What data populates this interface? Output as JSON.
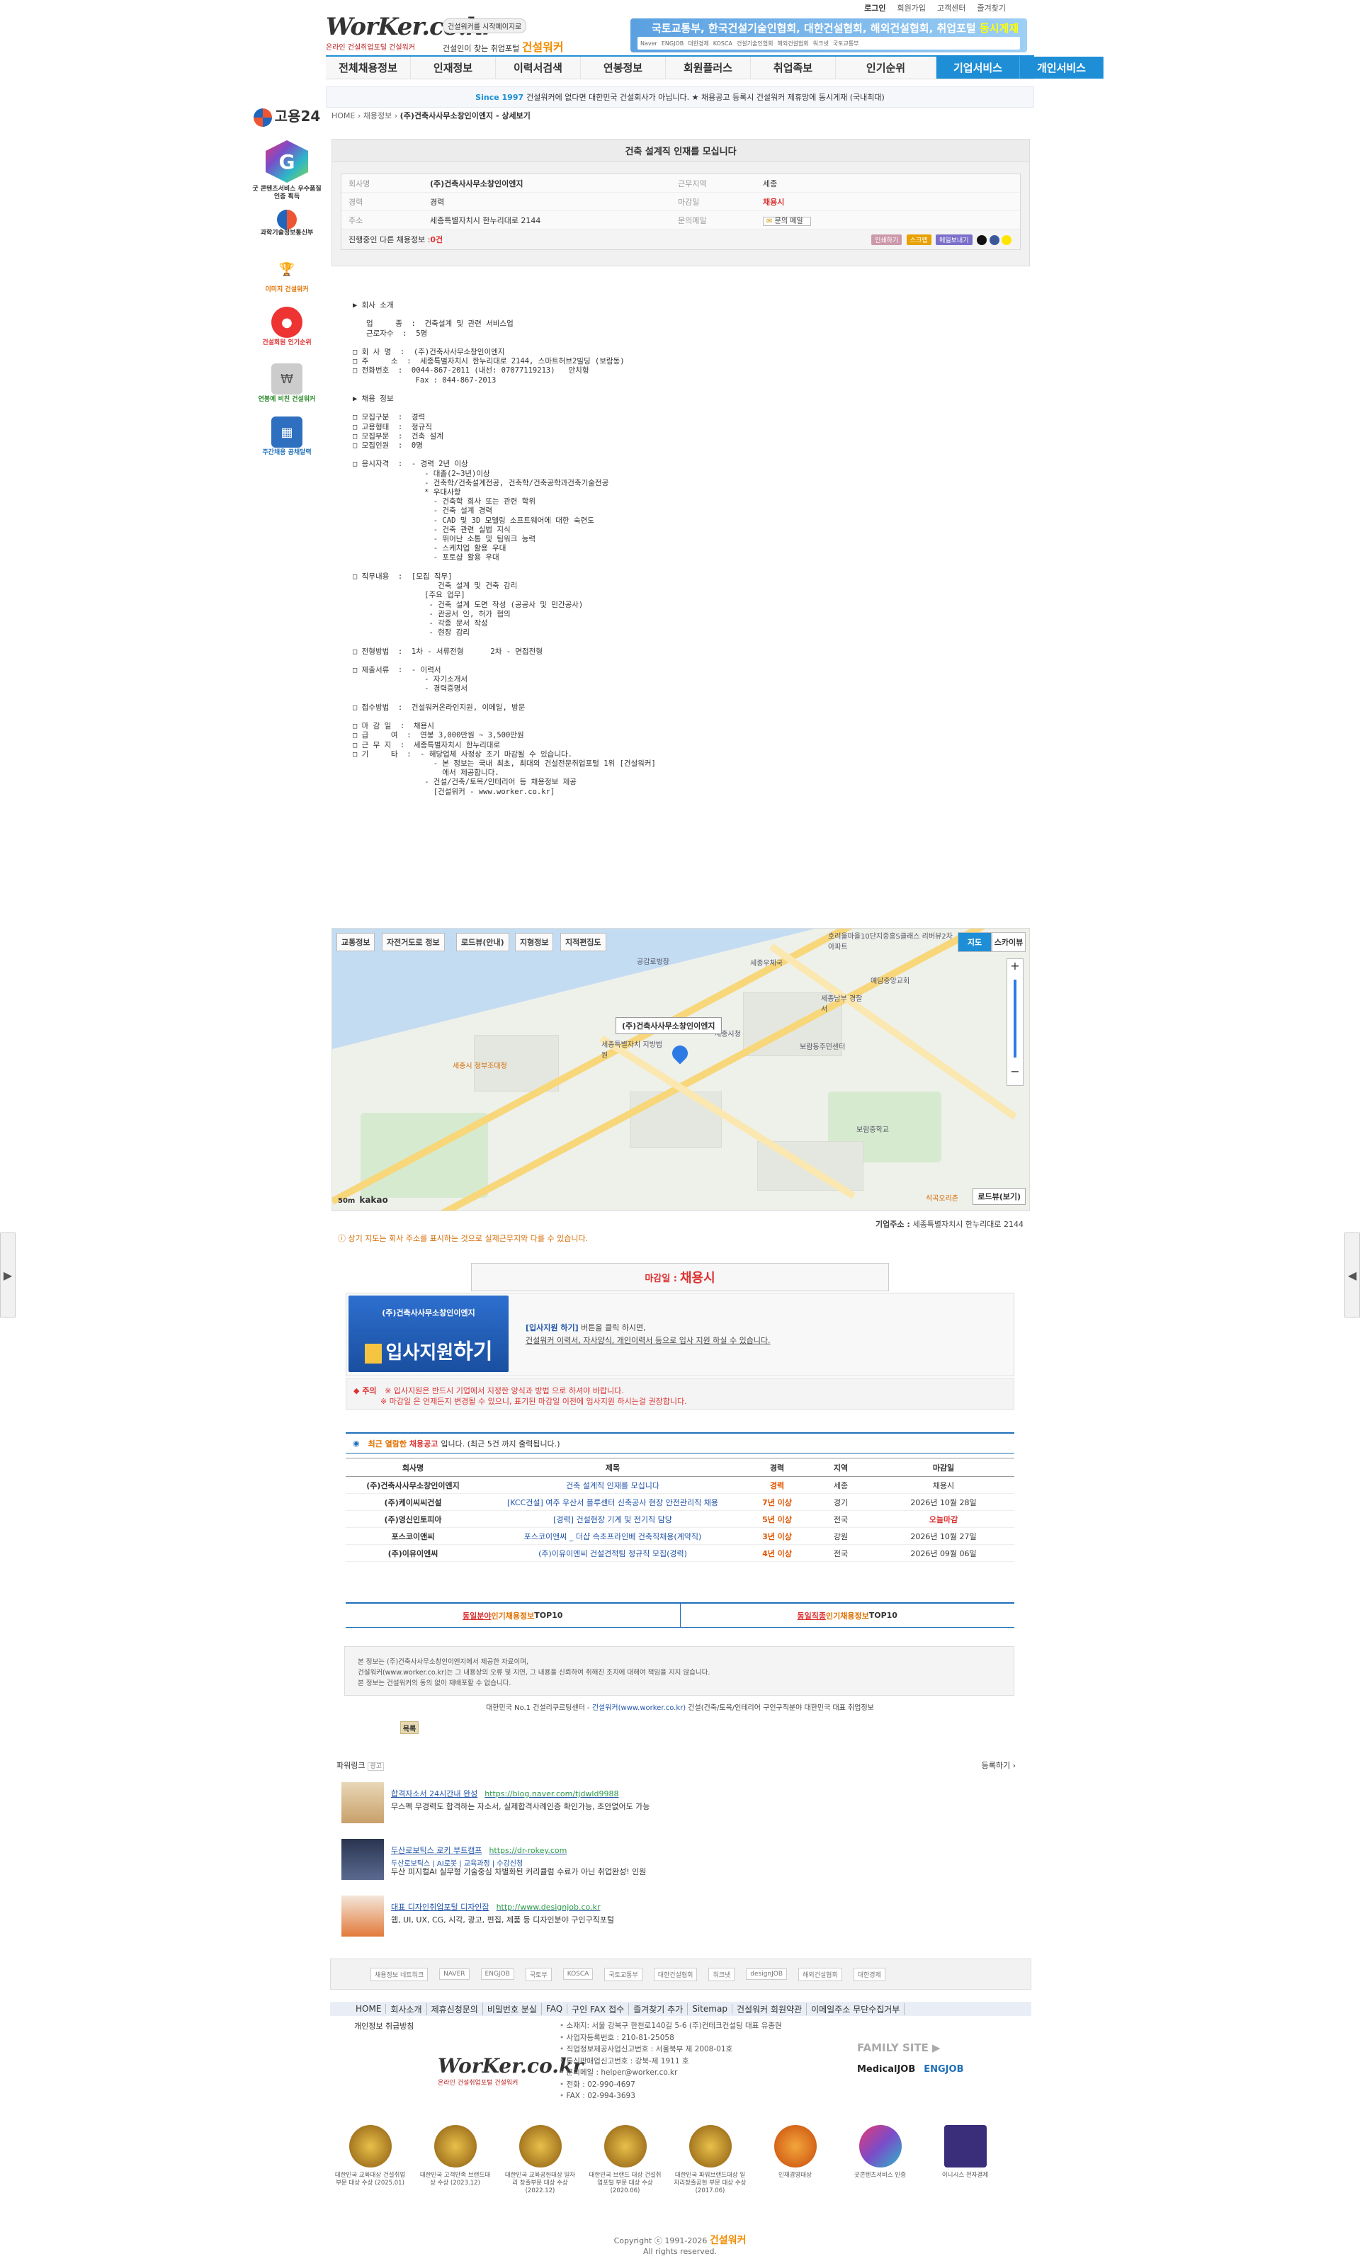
{
  "topbar": {
    "login": "로그인",
    "signup": "회원가입",
    "support": "고객센터",
    "bookmark": "즐겨찾기"
  },
  "logo": {
    "word": "WorKer.co.kr",
    "sub": "온라인 건설취업포털 건설워커"
  },
  "slogan": {
    "tag": "건설워커를 시작페이지로",
    "line": "건설인이 찾는 취업포털",
    "brand": "건설워커"
  },
  "ad_banner": {
    "text": "국토교통부, 한국건설기술인협회, 대한건설협회, 해외건설협회, 취업포털",
    "highlight": "동시게재",
    "partners": [
      "Naver",
      "ENGJOB",
      "대한경제",
      "KOSCA",
      "건설기술인협회",
      "해외건설협회",
      "워크넷",
      "국토교통부"
    ]
  },
  "nav": [
    "전체채용정보",
    "인재정보",
    "이력서검색",
    "연봉정보",
    "회원플러스",
    "취업족보",
    "인기순위",
    "기업서비스",
    "개인서비스"
  ],
  "since": {
    "year": "Since 1997",
    "text": "건설워커에 없다면 대한민국 건설회사가 아닙니다. ★ 채용공고 등록시 건설워커 제휴망에 동시게재 (국내최대)"
  },
  "rail": {
    "gov24": "고용24",
    "gcontent": "굿 콘텐츠서비스 우수품질인증 획득",
    "msit": "과학기술정보통신부",
    "item1": "이미지 건설워커",
    "item2": "건설회원 인기순위",
    "item3": "연봉에 비친 건설워커",
    "item4": "주간채용 공채달력"
  },
  "breadcrumb": {
    "home": "HOME",
    "mid": "채용정보",
    "current": "(주)건축사사무소창인이엔지 - 상세보기"
  },
  "posting": {
    "title": "건축 설계직 인재를 모십니다",
    "company_k": "회사명",
    "company": "(주)건축사사무소창인이엔지",
    "location_k": "근무지역",
    "location": "세종",
    "exp_k": "경력",
    "exp": "경력",
    "deadline_k": "마감일",
    "deadline": "채용시",
    "addr_k": "주소",
    "addr": "세종특별자치시 한누리대로 2144",
    "inquiry_k": "문의메일",
    "inquiry": "문의 메일",
    "other_jobs": "진행중인 다른 채용정보 : ",
    "other_count": "0건",
    "actions": [
      "인쇄하기",
      "스크랩",
      "메일보내기"
    ]
  },
  "detail_text": "▶ 회사 소개\n\n   업     종  :  건축설계 및 관련 서비스업\n   근로자수  :  5명\n\n□ 회 사 명  :  (주)건축사사무소창인이엔지\n□ 주     소  :  세종특별자치시 한누리대로 2144, 스마트허브2빌딩 (보람동)\n□ 전화번호  :  0044-867-2011 (내선: 07077119213)   안치형\n              Fax : 044-867-2013\n\n▶ 채용 정보\n\n□ 모집구분  :  경력\n□ 고용형태  :  정규직\n□ 모집부문  :  건축 설계\n□ 모집인원  :  0명\n\n□ 응시자격  :  - 경력 2년 이상\n                - 대졸(2~3년)이상\n                - 건축학/건축설계전공, 건축학/건축공학과건축기술전공\n                * 우대사항\n                  - 건축학 회사 또는 관련 학위\n                  - 건축 설계 경력\n                  - CAD 및 3D 모델링 소프트웨어에 대한 숙련도\n                  - 건축 관련 실법 지식\n                  - 뛰어난 소통 및 팀워크 능력\n                  - 스케치업 활용 우대\n                  - 포토샵 활용 우대\n\n□ 직무내용  :  [모집 직무]\n                   건축 설계 및 건축 감리\n                [주요 업무]\n                 - 건축 설계 도면 작성 (공공사 및 민간공사)\n                 - 관공서 인, 허가 협의\n                 - 각종 문서 작성\n                 - 현장 감리\n\n□ 전형방법  :  1차 - 서류전형      2차 - 면접전형\n\n□ 제출서류  :  - 이력서\n                - 자기소개서\n                - 경력증명서\n\n□ 접수방법  :  건설워커온라인지원, 이메일, 방문\n\n□ 마 감 일  :  채용시\n□ 급     여  :  연봉 3,000만원 ~ 3,500만원\n□ 근 무 지  :  세종특별자치시 한누리대로\n□ 기     타  :  - 해당업체 사정상 조기 마감될 수 있습니다.\n                  - 본 정보는 국내 최초, 최대의 건설전문취업포털 1위 [건설워커]\n                    에서 제공합니다.\n                - 건설/건축/토목/인테리어 등 채용정보 제공\n                  [건설워커 - www.worker.co.kr]",
  "map": {
    "tools": [
      "교통정보",
      "자전거도로 정보",
      "로드뷰(안내)",
      "지형정보",
      "지적편집도"
    ],
    "types": [
      "지도",
      "스카이뷰"
    ],
    "marker": "(주)건축사사무소창인이엔지",
    "roadview": "로드뷰(보기)",
    "brand": "kakao",
    "scale": "50m",
    "labels": [
      "공감로벙장",
      "호려울마을10단지중흥S클래스 리버뷰2차아파트",
      "세종우체국",
      "세종남부 경찰서",
      "예담중앙교회",
      "보람동주민센터",
      "세종시청",
      "세종특별자치 지방법원",
      "보람중학교",
      "세종시 정부조대정",
      "석곡오리촌"
    ],
    "address_label": "기업주소 : ",
    "address": "세종특별자치시 한누리대로 2144",
    "note": "상기 지도는 회사 주소를 표시하는 것으로 실제근무지와 다를 수 있습니다."
  },
  "apply": {
    "deadline_label": "마감일 : ",
    "deadline": "채용시",
    "company": "(주)건축사사무소창인이엔지",
    "button_prefix": "입사지원",
    "button_suffix": "하기",
    "desc1_link": "[입사지원 하기]",
    "desc1": " 버튼을 클릭 하시면,",
    "desc2": "건설워커 이력서, 자사양식, 개인이력서 등으로 입사 지원 하실 수 있습니다.",
    "caution_label": "주의",
    "caution1": "※ 입사지원은 반드시 기업에서 지정한 양식과 방법 으로 하셔야 바랍니다.",
    "caution2": "※ 마감일 은 언제든지 변경될 수 있으니, 표기된 마감일 이전에 입사지원 하시는걸 권장합니다."
  },
  "recent": {
    "caption_a": "최근 열람한",
    "caption_b": "채용공고",
    "caption_c": " 입니다.   (최근 5건 까지 출력됩니다.)",
    "headers": [
      "회사명",
      "제목",
      "경력",
      "지역",
      "마감일"
    ],
    "rows": [
      {
        "company": "(주)건축사사무소창인이엔지",
        "title": "건축 설계직 인재를 모십니다",
        "exp": "경력",
        "region": "세종",
        "deadline": "채용시"
      },
      {
        "company": "(주)케이씨씨건설",
        "title": "[KCC건설] 여주 우산서 플루센터 신축공사 현장 안전관리직 채용",
        "exp": "7년 이상",
        "region": "경기",
        "deadline": "2026년 10월 28일"
      },
      {
        "company": "(주)영신인토피아",
        "title": "[경력] 건설현장 기계 및 전기직 담당",
        "exp": "5년 이상",
        "region": "전국",
        "deadline": "오늘마감"
      },
      {
        "company": "포스코이앤씨",
        "title": "포스코이앤씨 _ 더샵 속초프라인베 건축직채용(계약직)",
        "exp": "3년 이상",
        "region": "강원",
        "deadline": "2026년 10월 27일"
      },
      {
        "company": "(주)이유이엔씨",
        "title": "(주)이유이엔씨 건설견적팀 정규직 모집(경력)",
        "exp": "4년 이상",
        "region": "전국",
        "deadline": "2026년 09월 06일"
      }
    ]
  },
  "top10": {
    "left_a": "동일분야",
    "left_b": " 인기채용정보",
    "left_c": " TOP10",
    "right_a": "동일직종",
    "right_b": " 인기채용정보",
    "right_c": " TOP10"
  },
  "notice": {
    "l1": "본 정보는 (주)건축사사무소창인이엔지에서 제공한 자료이며,",
    "l2": "건설워커(www.worker.co.kr)는 그 내용상의 오류 및 지연, 그 내용을 신뢰하여 취해진 조치에 대해여 책임을 지지 않습니다.",
    "l3": "본 정보는 건설워커의 동의 없이 재배포할 수 없습니다."
  },
  "credit": {
    "a": "대한민국 No.1 건설리쿠르팅센터 - ",
    "link": "건설워커(www.worker.co.kr)",
    "b": " 건설(건축/토목/인테리어 구인구직분야 대한민국 대표 취업정보"
  },
  "delete_button": "목록",
  "powerlink": {
    "label": "파워링크",
    "ad_mark": "광고",
    "register": "등록하기 ›",
    "ads": [
      {
        "title": "합격자소서 24시간내 완성",
        "url": "https://blog.naver.com/tjdwld9988",
        "sub": "",
        "desc": "무스펙 무경력도 합격하는 자소서, 실제합격사례인증 확인가능, 초안없어도 가능"
      },
      {
        "title": "두산로보틱스 로키 부트캠프",
        "url": "https://dr-rokey.com",
        "sub": "두산로보틱스 | AI로봇 | 교육과정 | 수강신청",
        "desc": "두산 피지컬AI 실무형 기술중심 차별화된 커리큘럼 수료가 아닌 취업완성! 인원"
      },
      {
        "title": "대표 디자인취업포털 디자인잡",
        "url": "http://www.designjob.co.kr",
        "sub": "",
        "desc": "웹, UI, UX, CG, 시각, 광고, 편집, 제품 등 디자인분야 구인구직포털"
      }
    ]
  },
  "partners": [
    "채용정보 네트워크",
    "NAVER",
    "ENGJOB",
    "국토부",
    "KOSCA",
    "국토교통부",
    "대한건설협회",
    "워크넷",
    "designJOB",
    "해외건설협회",
    "대한경제"
  ],
  "footnav": [
    "HOME",
    "회사소개",
    "제휴신청문의",
    "비밀번호 분실",
    "FAQ",
    "구인 FAX 접수",
    "즐겨찾기 추가",
    "Sitemap",
    "건설워커 회원약관",
    "이메일주소 무단수집거부"
  ],
  "privacy": "개인정보 취급방침",
  "footlogo": {
    "word": "WorKer.co.kr",
    "sub": "온라인 건설취업포털 건설워커"
  },
  "footinfo": [
    "소재지: 서울 강북구 한천로140길 5-6 (주)컨테크컨설팅 대표 유종현",
    "사업자등록번호 : 210-81-25058",
    "직업정보제공사업신고번호 : 서울북부 제 2008-01호",
    "통신판매업신고번호 : 강북-제 1911 호",
    "문의메일 : helper@worker.co.kr",
    "전화 : 02-990-4697",
    "FAX : 02-994-3693"
  ],
  "family": {
    "title": "FAMILY SITE ▶",
    "sites": [
      "MedicalJOB",
      "ENGJOB"
    ]
  },
  "awards": [
    {
      "label": "대한민국 교육대상 건설취업부문 대상 수상 (2025.01)"
    },
    {
      "label": "대한민국 고객만족 브랜드대상 수상 (2023.12)"
    },
    {
      "label": "대한민국 교육공헌대상 일자리 창출부문 대상 수상 (2022.12)"
    },
    {
      "label": "대한민국 브랜드 대상 건설취업포털 부문 대상 수상 (2020.06)"
    },
    {
      "label": "대한민국 파워브랜드대상 일자리창출공헌 부문 대상 수상 (2017.06)"
    },
    {
      "label": "인재경영대상"
    },
    {
      "label": "굿콘텐츠서비스 인증"
    },
    {
      "label": "이니시스 전자결제"
    }
  ],
  "copyright": {
    "a": "Copyright ⓒ 1991-2026 ",
    "brand": "건설워커",
    "b": "All rights reserved."
  }
}
